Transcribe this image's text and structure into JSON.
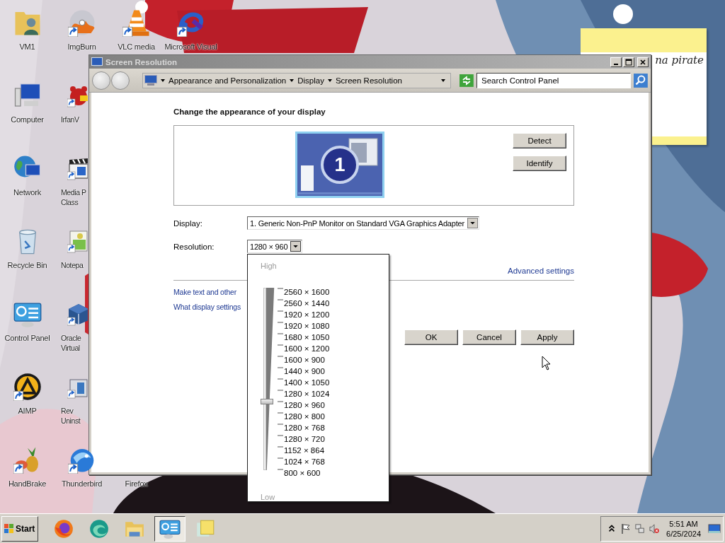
{
  "desktop_icons": [
    {
      "lines": [
        "VM1"
      ],
      "kind": "user-folder",
      "shortcut": false
    },
    {
      "lines": [
        "Computer"
      ],
      "kind": "computer",
      "shortcut": false
    },
    {
      "lines": [
        "Network"
      ],
      "kind": "globe",
      "shortcut": false
    },
    {
      "lines": [
        "Recycle Bin"
      ],
      "kind": "bin",
      "shortcut": false
    },
    {
      "lines": [
        "Control Panel"
      ],
      "kind": "panel",
      "shortcut": false
    },
    {
      "lines": [
        "AIMP"
      ],
      "kind": "aimp",
      "shortcut": true
    },
    {
      "lines": [
        "HandBrake"
      ],
      "kind": "pineapple",
      "shortcut": true
    },
    {
      "lines": [
        "ImgBurn"
      ],
      "kind": "disc",
      "shortcut": true
    },
    {
      "lines": [
        "IrfanV"
      ],
      "kind": "cat",
      "shortcut": true
    },
    {
      "lines": [
        "Media P",
        "Class"
      ],
      "kind": "film",
      "shortcut": true
    },
    {
      "lines": [
        "Notepa"
      ],
      "kind": "notepad",
      "shortcut": true
    },
    {
      "lines": [
        "Oracle",
        "Virtual"
      ],
      "kind": "cube",
      "shortcut": true
    },
    {
      "lines": [
        "Rev",
        "Uninst"
      ],
      "kind": "uninstaller",
      "shortcut": true
    },
    {
      "lines": [
        "Thunderbird"
      ],
      "kind": "bird",
      "shortcut": true
    },
    {
      "lines": [
        "VLC media"
      ],
      "kind": "cone",
      "shortcut": true
    },
    {
      "lines": [
        "Firefox"
      ]
    },
    {
      "lines": [
        "Microsoft Visual"
      ],
      "kind": "ribbon",
      "shortcut": true
    }
  ],
  "sticky_note": {
    "text": "na pirate"
  },
  "window": {
    "title": "Screen Resolution"
  },
  "address_bar": {
    "breadcrumbs": [
      "Appearance and Personalization",
      "Display",
      "Screen Resolution"
    ]
  },
  "search": {
    "placeholder": "Search Control Panel"
  },
  "heading": "Change the appearance of your display",
  "monitor": {
    "number": "1"
  },
  "side_buttons": [
    "Detect",
    "Identify"
  ],
  "display": {
    "label": "Display:",
    "value": "1. Generic Non-PnP Monitor on Standard VGA Graphics Adapter"
  },
  "resolution": {
    "label": "Resolution:",
    "value": "1280 × 960",
    "expanded": true
  },
  "resolution_menu": {
    "high_label": "High",
    "low_label": "Low",
    "slider": {
      "level": 0.375
    },
    "options": [
      "2560 × 1600",
      "2560 × 1440",
      "1920 × 1200",
      "1920 × 1080",
      "1680 × 1050",
      "1600 × 1200",
      "1600 × 900",
      "1440 × 900",
      "1400 × 1050",
      "1280 × 1024",
      "1280 × 960",
      "1280 × 800",
      "1280 × 768",
      "1280 × 720",
      "1152 × 864",
      "1024 × 768",
      "800 × 600"
    ]
  },
  "advanced_link": "Advanced settings",
  "links": [
    "Make text and other",
    "What display settings"
  ],
  "buttons": [
    "OK",
    "Cancel",
    "Apply"
  ],
  "taskbar": {
    "start": "Start",
    "apps": [
      {
        "kind": "firefox",
        "selected": false
      },
      {
        "kind": "swirl",
        "selected": false
      },
      {
        "kind": "explorer",
        "selected": false
      },
      {
        "kind": "control-panel",
        "selected": true
      },
      {
        "kind": "sticky-notes",
        "selected": false
      }
    ],
    "volume_muted": true,
    "clock": {
      "time": "5:51 AM",
      "date": "6/25/2024"
    }
  }
}
